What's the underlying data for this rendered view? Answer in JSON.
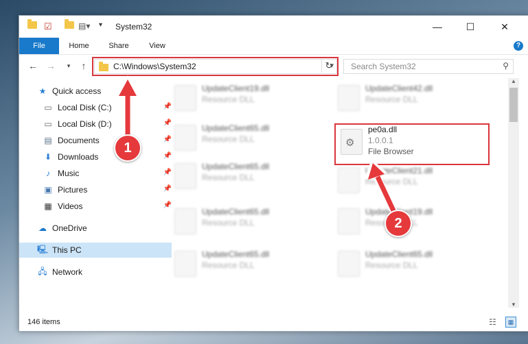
{
  "window": {
    "title": "System32"
  },
  "ribbon": {
    "tabs": [
      "File",
      "Home",
      "Share",
      "View"
    ],
    "help_label": "?"
  },
  "address": {
    "path": "C:\\Windows\\System32"
  },
  "search": {
    "placeholder": "Search System32"
  },
  "sidebar": {
    "items": [
      {
        "label": "Quick access",
        "icon": "star-icon"
      },
      {
        "label": "Local Disk (C:)",
        "icon": "drive-icon"
      },
      {
        "label": "Local Disk (D:)",
        "icon": "drive-icon"
      },
      {
        "label": "Documents",
        "icon": "documents-icon"
      },
      {
        "label": "Downloads",
        "icon": "download-icon"
      },
      {
        "label": "Music",
        "icon": "music-icon"
      },
      {
        "label": "Pictures",
        "icon": "pictures-icon"
      },
      {
        "label": "Videos",
        "icon": "videos-icon"
      },
      {
        "label": "OneDrive",
        "icon": "cloud-icon"
      },
      {
        "label": "This PC",
        "icon": "computer-icon"
      },
      {
        "label": "Network",
        "icon": "network-icon"
      }
    ]
  },
  "files": [
    {
      "name": "UpdateClient19.dll",
      "sub": "Resource DLL"
    },
    {
      "name": "UpdateClient42.dll",
      "sub": "Resource DLL"
    },
    {
      "name": "UpdateClient65.dll",
      "sub": "Resource DLL"
    },
    {
      "name": "pe0a.dll",
      "version": "1.0.0.1",
      "sub": "File Browser"
    },
    {
      "name": "UpdateClient65.dll",
      "sub": "Resource DLL"
    },
    {
      "name": "UpdateClient21.dll",
      "sub": "Resource DLL"
    },
    {
      "name": "UpdateClient65.dll",
      "sub": "Resource DLL"
    },
    {
      "name": "UpdateClient19.dll",
      "sub": "Resource DLL"
    },
    {
      "name": "UpdateClient65.dll",
      "sub": "Resource DLL"
    },
    {
      "name": "UpdateClient65.dll",
      "sub": "Resource DLL"
    }
  ],
  "status": {
    "count": "146 items"
  },
  "annotations": {
    "step1": "1",
    "step2": "2"
  },
  "colors": {
    "accent": "#1979ca",
    "highlight": "#d9353b",
    "selected": "#cce4f7"
  }
}
